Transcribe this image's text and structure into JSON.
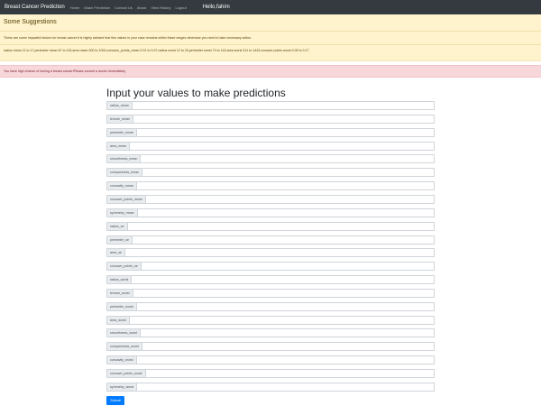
{
  "navbar": {
    "brand": "Breast Cancer Prediction",
    "links": [
      "Home",
      "Make Prediction",
      "Contact Us",
      "About",
      "View History",
      "Logout"
    ],
    "greeting": "Hello,fahim"
  },
  "suggestions": {
    "title": "Some Suggestions",
    "intro": "These are some impactful factors for breast cancer.It is highly advised that this values in your case remains within these ranges otherwise you need to take necessary action.",
    "ranges": "radius mean 11 to 17,perimeter mean 67 to 115,area mean 300 to 1000,concave_points_mean 0.01 to 0.07,radius worst 12 to 20,perimeter worst 74 to 140,area worst 311 to 1443,concave points worst 0.05 to 0.17"
  },
  "alert": {
    "text": "You have high chance of having a breast cancer!Please consult a doctor immediately"
  },
  "form": {
    "title": "Input your values to make predictions",
    "fields": [
      "radius_mean",
      "texture_mean",
      "perimeter_mean",
      "area_mean",
      "smoothness_mean",
      "compactness_mean",
      "concavity_mean",
      "concave_points_mean",
      "symmetry_mean",
      "radius_se",
      "perimeter_se",
      "area_se",
      "concave_points_se",
      "radius_worst",
      "texture_worst",
      "perimeter_worst",
      "area_worst",
      "smoothness_worst",
      "compactness_worst",
      "concavity_worst",
      "concave_points_worst",
      "symmetry_worst"
    ],
    "submit": "Submit"
  }
}
